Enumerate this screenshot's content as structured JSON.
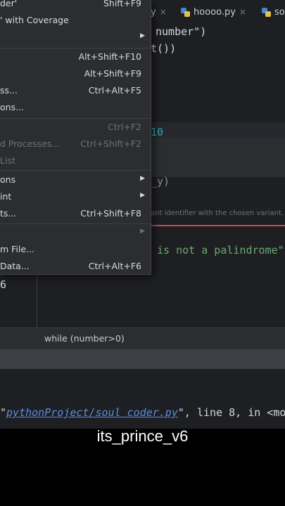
{
  "tabs": [
    {
      "label": "y",
      "close": "×"
    },
    {
      "label": "hoooo.py",
      "close": "×"
    },
    {
      "label": "so"
    }
  ],
  "editor": {
    "line1_name": "number",
    "line1_close": "\")",
    "line2": "t())",
    "line3_number": "10",
    "line4": "_y)",
    "tip": "ant identifier with the chosen variant.",
    "line5_string": " is not a palindrome\"",
    "gutter_number": "6"
  },
  "breadcrumb": "while (number>0)",
  "run_output": {
    "path": "pythonProject/soul coder.py",
    "rest": "\", line 8, in <mod"
  },
  "menu": {
    "items": [
      {
        "label": "der'",
        "shortcut": "Shift+F9",
        "disabled": false
      },
      {
        "label": "' with Coverage",
        "shortcut": "",
        "disabled": false
      },
      {
        "label": "",
        "shortcut": "",
        "submenu": true,
        "disabled": false
      },
      {
        "label": "",
        "shortcut": "Alt+Shift+F10",
        "disabled": false
      },
      {
        "label": "",
        "shortcut": "Alt+Shift+F9",
        "disabled": false
      },
      {
        "label": "ss...",
        "shortcut": "Ctrl+Alt+F5",
        "disabled": false
      },
      {
        "label": "ons...",
        "shortcut": "",
        "disabled": false
      },
      {
        "label": "",
        "shortcut": "Ctrl+F2",
        "disabled": true
      },
      {
        "label": "d Processes...",
        "shortcut": "Ctrl+Shift+F2",
        "disabled": true
      },
      {
        "label": "List",
        "shortcut": "",
        "disabled": true
      },
      {
        "label": "ons",
        "shortcut": "",
        "submenu": true,
        "disabled": false
      },
      {
        "label": "int",
        "shortcut": "",
        "submenu": true,
        "disabled": false
      },
      {
        "label": "ts...",
        "shortcut": "Ctrl+Shift+F8",
        "disabled": false
      },
      {
        "label": "",
        "shortcut": "",
        "submenu": true,
        "disabled": true
      },
      {
        "label": "m File...",
        "shortcut": "",
        "disabled": false
      },
      {
        "label": " Data...",
        "shortcut": "Ctrl+Alt+F6",
        "disabled": false
      }
    ]
  },
  "caption": "its_prince_v6",
  "colors": {
    "string": "#6aab73",
    "number": "#2aacb8",
    "error": "#c74e4e",
    "link": "#5b8ed8"
  }
}
